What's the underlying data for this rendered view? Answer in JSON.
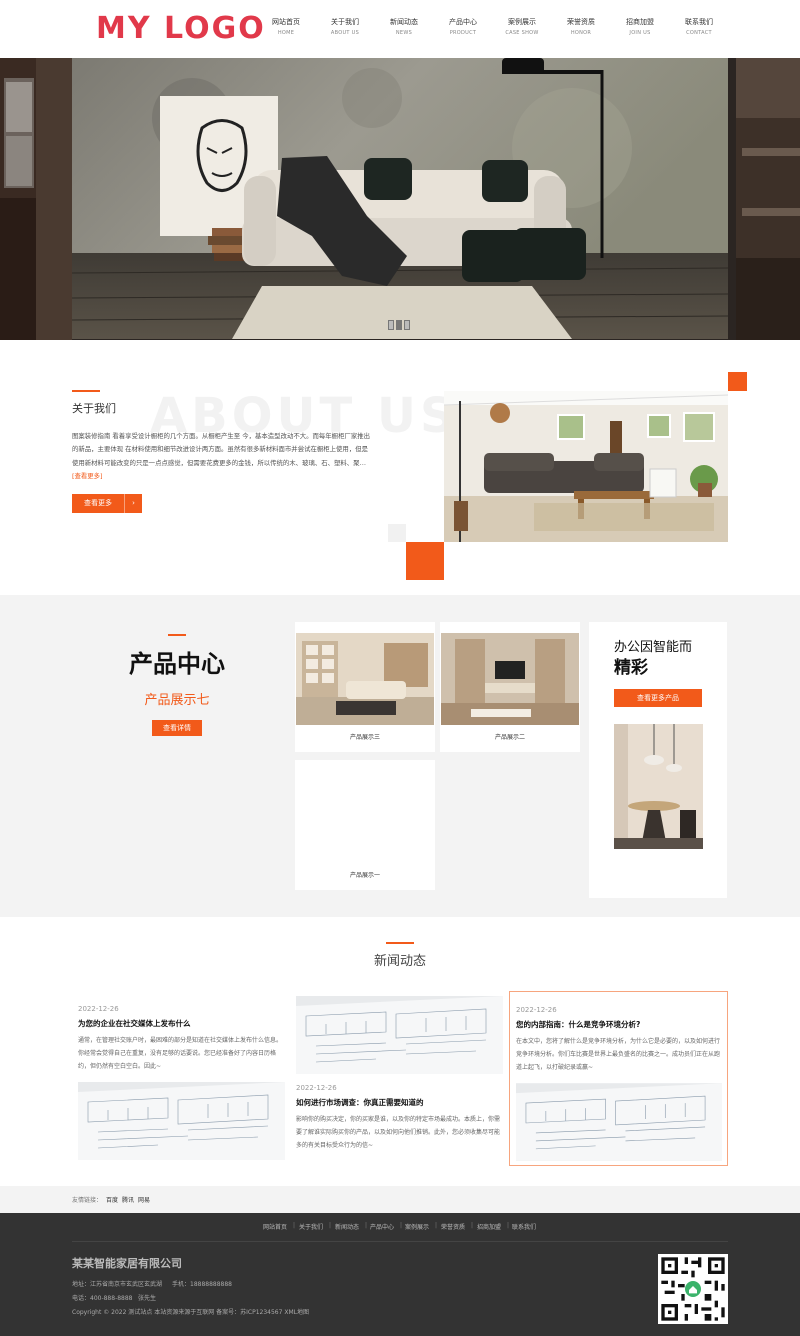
{
  "header": {
    "logo": "MY LOGO",
    "nav": [
      {
        "cn": "网站首页",
        "en": "HOME"
      },
      {
        "cn": "关于我们",
        "en": "ABOUT US"
      },
      {
        "cn": "新闻动态",
        "en": "NEWS"
      },
      {
        "cn": "产品中心",
        "en": "PRODUCT"
      },
      {
        "cn": "案例展示",
        "en": "CASE SHOW"
      },
      {
        "cn": "荣誉资质",
        "en": "HONOR"
      },
      {
        "cn": "招商加盟",
        "en": "JOIN US"
      },
      {
        "cn": "联系我们",
        "en": "CONTACT"
      }
    ]
  },
  "banner": {
    "slides": 3,
    "active": 1
  },
  "about": {
    "title": "关于我们",
    "bg_text": "ABOUT US",
    "text": "图案装修指南 看着享受设计橱柜的几个方面。从橱柜产生至 今，基本造型改动不大。而每年橱柜厂家推出的新品，主要体现 在材料使用和细节改进设计两方面。虽然有很多新材料面市并尝试在橱柜上使用，但是使用新材料可能改变的只是一点点感觉，但需要花费更多的金钱，所以传统的木、玻璃、石、塑料、聚…",
    "more_link": "[查看更多]",
    "button": "查看更多",
    "button_arrow": "›"
  },
  "products": {
    "title": "产品中心",
    "subtitle": "产品展示七",
    "detail_button": "查看详情",
    "items": [
      {
        "label": "产品展示三"
      },
      {
        "label": "产品展示二"
      },
      {
        "label": "产品展示一"
      }
    ],
    "promo": {
      "line1": "办公因智能而",
      "line2": "精彩",
      "button": "查看更多产品"
    }
  },
  "news": {
    "title": "新闻动态",
    "items": [
      {
        "date": "2022-12-26",
        "title": "为您的企业在社交媒体上发布什么",
        "text": "通常，在管理社交账户时，最困难的部分是知道在社交媒体上发布什么信息。你经常会觉得自己在重复，没有足够的话要说。您已经准备好了内容日历格约，但仍然有空白空白。因此~"
      },
      {
        "date": "2022-12-26",
        "title": "如何进行市场调查：你真正需要知道的",
        "text": "影响你的购买决定，你的买家是谁，以及你的特定市场最成功。本质上，你需要了解谁实际购买你的产品，以及如何向他们推销。此外，您必须收集尽可能多的有关目标受众行为的信~"
      },
      {
        "date": "2022-12-26",
        "title": "您的内部指南：什么是竞争环境分析?",
        "text": "在本文中，您将了解什么是竞争环境分析，为什么它是必要的，以及如何进行竞争环境分析。你们车比赛是世界上最负盛名的比赛之一。成功员们正在从跑道上起飞，以打破纪录或赢~"
      }
    ]
  },
  "links": {
    "label": "友情链接：",
    "items": [
      "百度",
      "腾讯",
      "网易"
    ]
  },
  "footer": {
    "nav": [
      "网站首页",
      "关于我们",
      "新闻动态",
      "产品中心",
      "案例展示",
      "荣誉资质",
      "招商加盟",
      "联系我们"
    ],
    "company": "某某智能家居有限公司",
    "address": "地址：江苏省南京市玄武区玄武湖",
    "mobile": "手机：18888888888",
    "phone": "电话：400-888-8888",
    "contact": "张先生",
    "copyright": "Copyright © 2022 测试站点 本站资源来源于互联网 备案号：苏ICP1234567 XML地图"
  },
  "colors": {
    "accent": "#f25a1a",
    "logo": "#e1394a",
    "footer": "#333333"
  }
}
